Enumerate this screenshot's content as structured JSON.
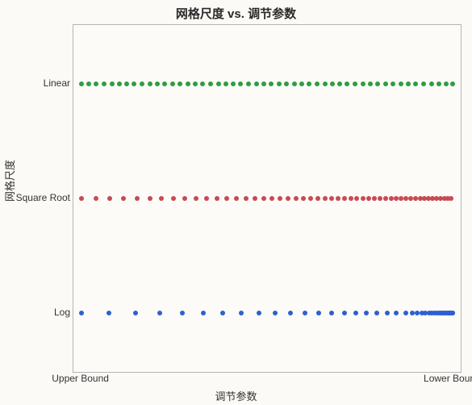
{
  "chart_data": {
    "type": "scatter",
    "title": "网格尺度 vs. 调节参数",
    "xlabel": "调节参数",
    "ylabel": "网格尺度",
    "x_axis": {
      "range_norm": [
        0,
        1
      ],
      "ticks": [
        {
          "pos": 0.02,
          "label": "Upper Bound"
        },
        {
          "pos": 0.98,
          "label": "Lower Bound"
        }
      ]
    },
    "y_axis": {
      "categories": [
        {
          "name": "Linear",
          "pos": 0.17
        },
        {
          "name": "Square Root",
          "pos": 0.5
        },
        {
          "name": "Log",
          "pos": 0.83
        }
      ]
    },
    "series": [
      {
        "name": "Linear",
        "color": "#2e9e3f",
        "y": 0.17,
        "x": [
          0.02,
          0.04,
          0.059,
          0.079,
          0.099,
          0.118,
          0.138,
          0.157,
          0.177,
          0.197,
          0.216,
          0.236,
          0.256,
          0.275,
          0.295,
          0.315,
          0.334,
          0.354,
          0.374,
          0.393,
          0.413,
          0.432,
          0.452,
          0.472,
          0.491,
          0.511,
          0.531,
          0.55,
          0.57,
          0.59,
          0.609,
          0.629,
          0.649,
          0.668,
          0.688,
          0.707,
          0.727,
          0.747,
          0.766,
          0.786,
          0.806,
          0.825,
          0.845,
          0.865,
          0.884,
          0.904,
          0.924,
          0.943,
          0.963,
          0.98
        ]
      },
      {
        "name": "Square Root",
        "color": "#c84a52",
        "y": 0.5,
        "x": [
          0.02,
          0.058,
          0.094,
          0.13,
          0.164,
          0.197,
          0.228,
          0.259,
          0.288,
          0.317,
          0.344,
          0.371,
          0.396,
          0.421,
          0.445,
          0.468,
          0.491,
          0.513,
          0.534,
          0.555,
          0.575,
          0.594,
          0.613,
          0.631,
          0.649,
          0.667,
          0.684,
          0.7,
          0.716,
          0.732,
          0.748,
          0.763,
          0.778,
          0.792,
          0.806,
          0.82,
          0.833,
          0.846,
          0.859,
          0.871,
          0.883,
          0.895,
          0.906,
          0.917,
          0.928,
          0.938,
          0.948,
          0.958,
          0.967,
          0.976
        ]
      },
      {
        "name": "Log",
        "color": "#2f5fd0",
        "y": 0.83,
        "x": [
          0.02,
          0.092,
          0.16,
          0.222,
          0.281,
          0.335,
          0.386,
          0.434,
          0.479,
          0.521,
          0.561,
          0.598,
          0.634,
          0.667,
          0.699,
          0.729,
          0.757,
          0.784,
          0.81,
          0.834,
          0.858,
          0.876,
          0.888,
          0.899,
          0.909,
          0.918,
          0.926,
          0.932,
          0.938,
          0.943,
          0.948,
          0.952,
          0.956,
          0.96,
          0.963,
          0.966,
          0.968,
          0.97,
          0.972,
          0.974,
          0.976,
          0.977,
          0.978,
          0.979,
          0.98
        ]
      }
    ]
  }
}
